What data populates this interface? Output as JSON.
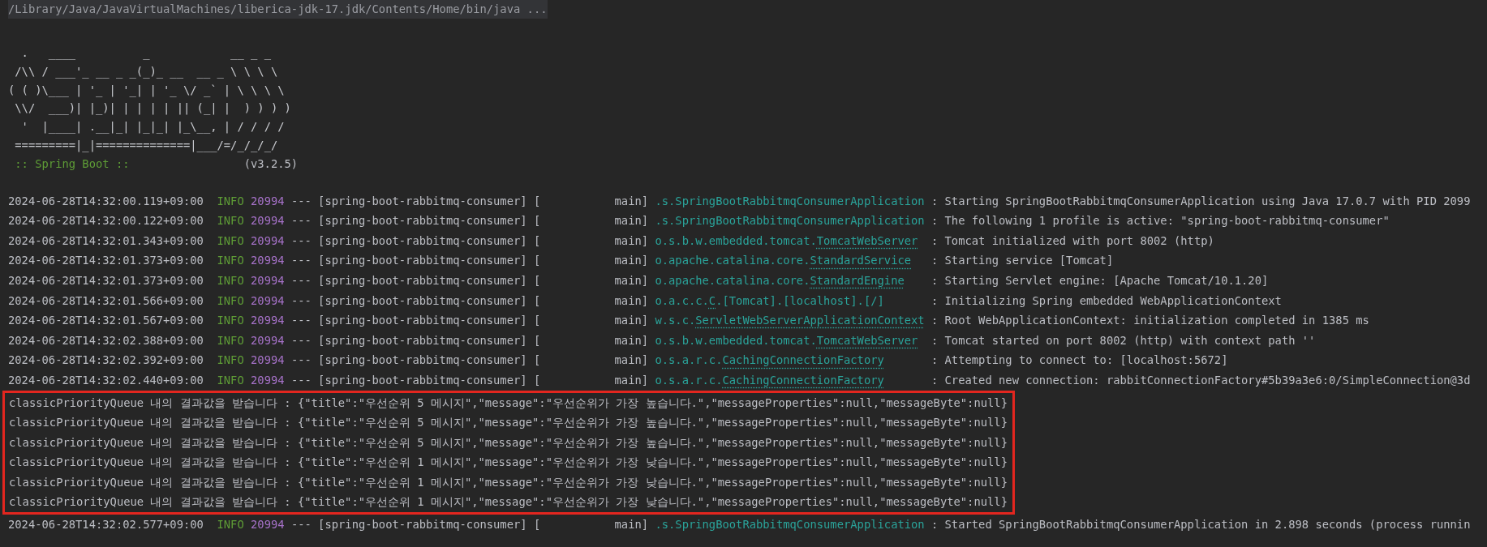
{
  "command_line": "/Library/Java/JavaVirtualMachines/liberica-jdk-17.jdk/Contents/Home/bin/java ...",
  "banner": {
    "lines": [
      "  .   ____          _            __ _ _",
      " /\\\\ / ___'_ __ _ _(_)_ __  __ _ \\ \\ \\ \\",
      "( ( )\\___ | '_ | '_| | '_ \\/ _` | \\ \\ \\ \\",
      " \\\\/  ___)| |_)| | | | | || (_| |  ) ) ) )",
      "  '  |____| .__|_| |_|_| |_\\__, | / / / /",
      " =========|_|==============|___/=/_/_/_/"
    ],
    "label": ":: Spring Boot ::",
    "version": "(v3.2.5)"
  },
  "entries": [
    {
      "kind": "log",
      "time": "2024-06-28T14:32:00.119+09:00",
      "level": "INFO",
      "pid": "20994",
      "sep": "---",
      "app": "[spring-boot-rabbitmq-consumer]",
      "thread": "[           main]",
      "logger": [
        {
          "text": ".s.SpringBootRabbitmqConsumerApplication",
          "linked": false
        }
      ],
      "message": ": Starting SpringBootRabbitmqConsumerApplication using Java 17.0.7 with PID 2099"
    },
    {
      "kind": "log",
      "time": "2024-06-28T14:32:00.122+09:00",
      "level": "INFO",
      "pid": "20994",
      "sep": "---",
      "app": "[spring-boot-rabbitmq-consumer]",
      "thread": "[           main]",
      "logger": [
        {
          "text": ".s.SpringBootRabbitmqConsumerApplication",
          "linked": false
        }
      ],
      "message": ": The following 1 profile is active: \"spring-boot-rabbitmq-consumer\""
    },
    {
      "kind": "log",
      "time": "2024-06-28T14:32:01.343+09:00",
      "level": "INFO",
      "pid": "20994",
      "sep": "---",
      "app": "[spring-boot-rabbitmq-consumer]",
      "thread": "[           main]",
      "logger": [
        {
          "text": "o.s.b.w.embedded.tomcat.",
          "linked": false
        },
        {
          "text": "TomcatWebServer",
          "linked": true
        }
      ],
      "message": ": Tomcat initialized with port 8002 (http)"
    },
    {
      "kind": "log",
      "time": "2024-06-28T14:32:01.373+09:00",
      "level": "INFO",
      "pid": "20994",
      "sep": "---",
      "app": "[spring-boot-rabbitmq-consumer]",
      "thread": "[           main]",
      "logger": [
        {
          "text": "o.apache.catalina.core.",
          "linked": false
        },
        {
          "text": "StandardService",
          "linked": true
        }
      ],
      "message": ": Starting service [Tomcat]"
    },
    {
      "kind": "log",
      "time": "2024-06-28T14:32:01.373+09:00",
      "level": "INFO",
      "pid": "20994",
      "sep": "---",
      "app": "[spring-boot-rabbitmq-consumer]",
      "thread": "[           main]",
      "logger": [
        {
          "text": "o.apache.catalina.core.",
          "linked": false
        },
        {
          "text": "StandardEngine",
          "linked": true
        }
      ],
      "message": ": Starting Servlet engine: [Apache Tomcat/10.1.20]"
    },
    {
      "kind": "log",
      "time": "2024-06-28T14:32:01.566+09:00",
      "level": "INFO",
      "pid": "20994",
      "sep": "---",
      "app": "[spring-boot-rabbitmq-consumer]",
      "thread": "[           main]",
      "logger": [
        {
          "text": "o.a.c.c.",
          "linked": false
        },
        {
          "text": "C",
          "linked": true
        },
        {
          "text": ".[Tomcat].[localhost].[/]",
          "linked": false
        }
      ],
      "message": ": Initializing Spring embedded WebApplicationContext"
    },
    {
      "kind": "log",
      "time": "2024-06-28T14:32:01.567+09:00",
      "level": "INFO",
      "pid": "20994",
      "sep": "---",
      "app": "[spring-boot-rabbitmq-consumer]",
      "thread": "[           main]",
      "logger": [
        {
          "text": "w.s.c.",
          "linked": false
        },
        {
          "text": "ServletWebServerApplicationContext",
          "linked": true
        }
      ],
      "message": ": Root WebApplicationContext: initialization completed in 1385 ms"
    },
    {
      "kind": "log",
      "time": "2024-06-28T14:32:02.388+09:00",
      "level": "INFO",
      "pid": "20994",
      "sep": "---",
      "app": "[spring-boot-rabbitmq-consumer]",
      "thread": "[           main]",
      "logger": [
        {
          "text": "o.s.b.w.embedded.tomcat.",
          "linked": false
        },
        {
          "text": "TomcatWebServer",
          "linked": true
        }
      ],
      "message": ": Tomcat started on port 8002 (http) with context path ''"
    },
    {
      "kind": "log",
      "time": "2024-06-28T14:32:02.392+09:00",
      "level": "INFO",
      "pid": "20994",
      "sep": "---",
      "app": "[spring-boot-rabbitmq-consumer]",
      "thread": "[           main]",
      "logger": [
        {
          "text": "o.s.a.r.c.",
          "linked": false
        },
        {
          "text": "CachingConnectionFactory",
          "linked": true
        }
      ],
      "message": ": Attempting to connect to: [localhost:5672]"
    },
    {
      "kind": "log",
      "time": "2024-06-28T14:32:02.440+09:00",
      "level": "INFO",
      "pid": "20994",
      "sep": "---",
      "app": "[spring-boot-rabbitmq-consumer]",
      "thread": "[           main]",
      "logger": [
        {
          "text": "o.s.a.r.c.",
          "linked": false
        },
        {
          "text": "CachingConnectionFactory",
          "linked": true
        }
      ],
      "message": ": Created new connection: rabbitConnectionFactory#5b39a3e6:0/SimpleConnection@3d"
    },
    {
      "kind": "highlighted_output",
      "lines": [
        "classicPriorityQueue 내의 결과값을 받습니다 : {\"title\":\"우선순위 5 메시지\",\"message\":\"우선순위가 가장 높습니다.\",\"messageProperties\":null,\"messageByte\":null}",
        "classicPriorityQueue 내의 결과값을 받습니다 : {\"title\":\"우선순위 5 메시지\",\"message\":\"우선순위가 가장 높습니다.\",\"messageProperties\":null,\"messageByte\":null}",
        "classicPriorityQueue 내의 결과값을 받습니다 : {\"title\":\"우선순위 5 메시지\",\"message\":\"우선순위가 가장 높습니다.\",\"messageProperties\":null,\"messageByte\":null}",
        "classicPriorityQueue 내의 결과값을 받습니다 : {\"title\":\"우선순위 1 메시지\",\"message\":\"우선순위가 가장 낮습니다.\",\"messageProperties\":null,\"messageByte\":null}",
        "classicPriorityQueue 내의 결과값을 받습니다 : {\"title\":\"우선순위 1 메시지\",\"message\":\"우선순위가 가장 낮습니다.\",\"messageProperties\":null,\"messageByte\":null}",
        "classicPriorityQueue 내의 결과값을 받습니다 : {\"title\":\"우선순위 1 메시지\",\"message\":\"우선순위가 가장 낮습니다.\",\"messageProperties\":null,\"messageByte\":null}"
      ]
    },
    {
      "kind": "log",
      "time": "2024-06-28T14:32:02.577+09:00",
      "level": "INFO",
      "pid": "20994",
      "sep": "---",
      "app": "[spring-boot-rabbitmq-consumer]",
      "thread": "[           main]",
      "logger": [
        {
          "text": ".s.SpringBootRabbitmqConsumerApplication",
          "linked": false
        }
      ],
      "message": ": Started SpringBootRabbitmqConsumerApplication in 2.898 seconds (process runnin"
    }
  ]
}
